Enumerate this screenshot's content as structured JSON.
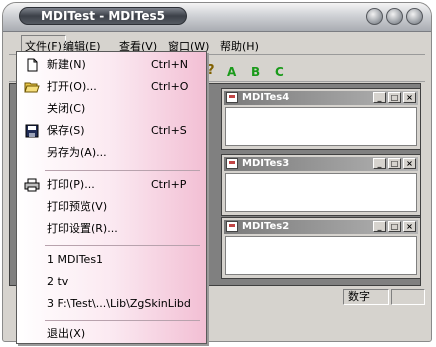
{
  "window": {
    "title": "MDITest - MDITes5"
  },
  "menubar": {
    "items": [
      {
        "label": "文件(F)",
        "key": "F"
      },
      {
        "label": "编辑(E)",
        "key": "E"
      },
      {
        "label": "查看(V)",
        "key": "V"
      },
      {
        "label": "窗口(W)",
        "key": "W"
      },
      {
        "label": "帮助(H)",
        "key": "H"
      }
    ]
  },
  "toolbar": {
    "letters": [
      "A",
      "B",
      "C"
    ],
    "letter_color": "#1a9a1a",
    "help_icon": "help-cursor-icon"
  },
  "mdi_children": [
    {
      "title": "MDITes4"
    },
    {
      "title": "MDITes3"
    },
    {
      "title": "MDITes2"
    }
  ],
  "statusbar": {
    "numlock": "数字"
  },
  "file_menu": {
    "items": [
      {
        "label": "新建(N)",
        "shortcut": "Ctrl+N",
        "icon": "new-file-icon"
      },
      {
        "label": "打开(O)...",
        "shortcut": "Ctrl+O",
        "icon": "open-folder-icon"
      },
      {
        "label": "关闭(C)",
        "shortcut": ""
      },
      {
        "label": "保存(S)",
        "shortcut": "Ctrl+S",
        "icon": "save-disk-icon"
      },
      {
        "label": "另存为(A)...",
        "shortcut": ""
      },
      {
        "label": "打印(P)...",
        "shortcut": "Ctrl+P",
        "icon": "printer-icon"
      },
      {
        "label": "打印预览(V)",
        "shortcut": ""
      },
      {
        "label": "打印设置(R)...",
        "shortcut": ""
      },
      {
        "label": "1 MDITes1",
        "shortcut": ""
      },
      {
        "label": "2 tv",
        "shortcut": ""
      },
      {
        "label": "3 F:\\Test\\...\\Lib\\ZgSkinLibd",
        "shortcut": ""
      },
      {
        "label": "退出(X)",
        "shortcut": ""
      }
    ]
  },
  "colors": {
    "menu_gradient_end": "#f2bfd4",
    "frame": "#d6d3ce",
    "mdi_background": "#808080"
  }
}
